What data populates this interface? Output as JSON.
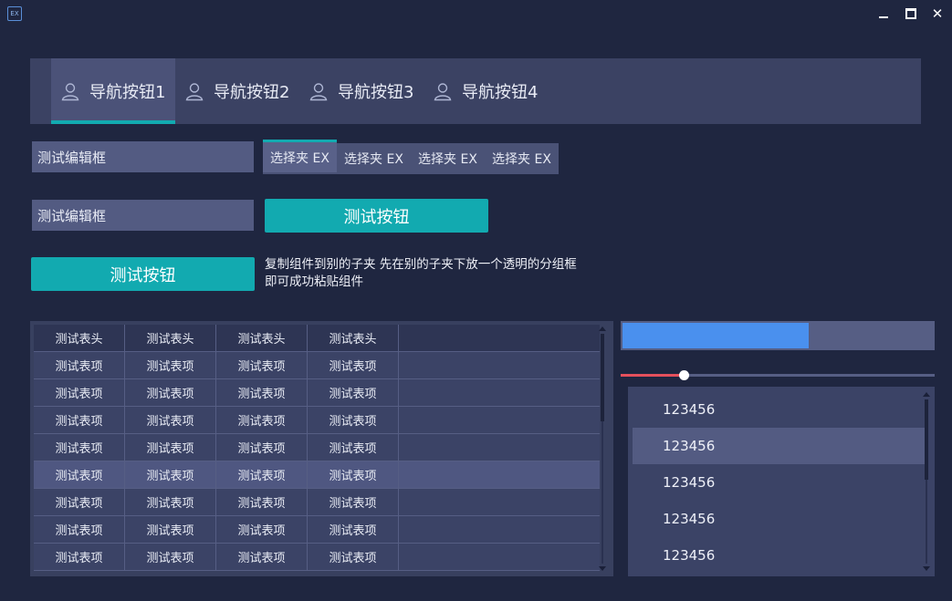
{
  "window": {
    "app_icon_text": "EX",
    "minimize_icon": "minimize-icon",
    "maximize_icon": "maximize-icon",
    "close_icon": "close-icon",
    "close_glyph": "✕"
  },
  "colors": {
    "background": "#1f2640",
    "panel": "#3b4263",
    "accent": "#12aab0",
    "progress": "#4a90ee",
    "slider": "#e5505c"
  },
  "nav": {
    "active_index": 0,
    "items": [
      {
        "label": "导航按钮1",
        "icon": "user-icon"
      },
      {
        "label": "导航按钮2",
        "icon": "user-icon"
      },
      {
        "label": "导航按钮3",
        "icon": "user-icon"
      },
      {
        "label": "导航按钮4",
        "icon": "user-icon"
      }
    ]
  },
  "edits": [
    {
      "value": "测试编辑框"
    },
    {
      "value": "测试编辑框"
    }
  ],
  "tabs": {
    "active_index": 0,
    "items": [
      "选择夹 EX",
      "选择夹 EX",
      "选择夹 EX",
      "选择夹 EX"
    ]
  },
  "buttons": [
    {
      "label": "测试按钮"
    },
    {
      "label": "测试按钮"
    }
  ],
  "note": {
    "line1": "复制组件到别的子夹 先在别的子夹下放一个透明的分组框",
    "line2": "即可成功粘贴组件"
  },
  "table": {
    "headers": [
      "测试表头",
      "测试表头",
      "测试表头",
      "测试表头"
    ],
    "selected_row": 4,
    "rows": [
      [
        "测试表项",
        "测试表项",
        "测试表项",
        "测试表项"
      ],
      [
        "测试表项",
        "测试表项",
        "测试表项",
        "测试表项"
      ],
      [
        "测试表项",
        "测试表项",
        "测试表项",
        "测试表项"
      ],
      [
        "测试表项",
        "测试表项",
        "测试表项",
        "测试表项"
      ],
      [
        "测试表项",
        "测试表项",
        "测试表项",
        "测试表项"
      ],
      [
        "测试表项",
        "测试表项",
        "测试表项",
        "测试表项"
      ],
      [
        "测试表项",
        "测试表项",
        "测试表项",
        "测试表项"
      ],
      [
        "测试表项",
        "测试表项",
        "测试表项",
        "测试表项"
      ]
    ]
  },
  "progress": {
    "value_fraction": 0.6
  },
  "slider": {
    "value_fraction": 0.2
  },
  "list": {
    "selected_index": 1,
    "items": [
      "123456",
      "123456",
      "123456",
      "123456",
      "123456"
    ]
  }
}
